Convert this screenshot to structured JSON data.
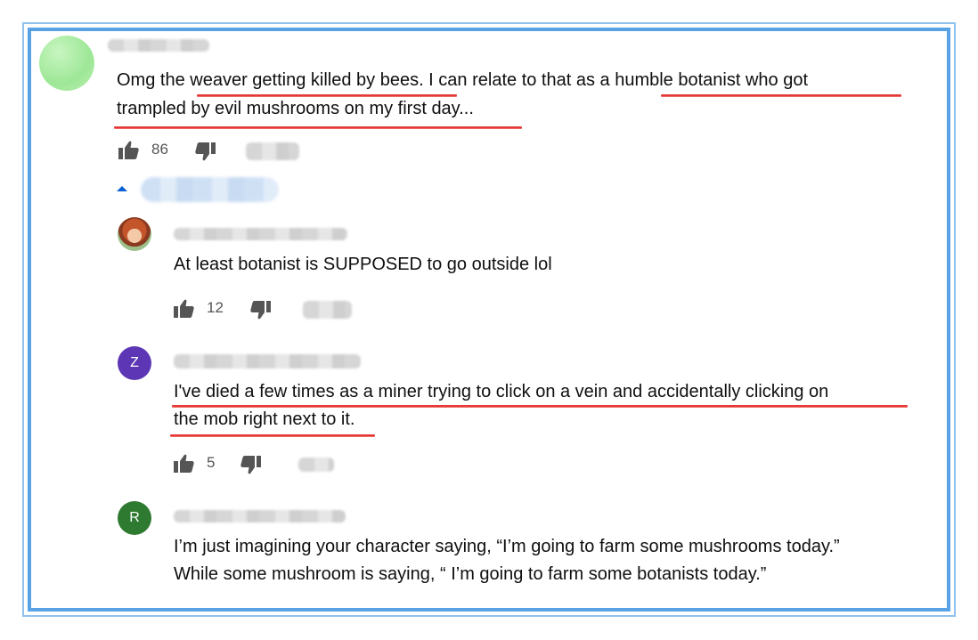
{
  "comments": [
    {
      "text": "Omg the weaver getting killed by bees. I can relate to that as a humble botanist who got trampled by evil mushrooms on my first day...",
      "line1": "Omg the weaver getting killed by bees. I can relate to that as a humble botanist who got",
      "line2": "trampled by evil mushrooms on my first day...",
      "likes": "86"
    }
  ],
  "replies": [
    {
      "avatar_initial": "",
      "text": "At least botanist is SUPPOSED to go outside lol",
      "likes": "12"
    },
    {
      "avatar_initial": "Z",
      "line1": "I've died a few times as a miner trying to click on a vein and accidentally clicking on",
      "line2": "the mob right next to it.",
      "likes": "5"
    },
    {
      "avatar_initial": "R",
      "line1": "I’m just imagining your character saying, “I’m going to farm some mushrooms today.”",
      "line2": "While some mushroom is saying, “ I’m going to farm some botanists today.”"
    }
  ],
  "colors": {
    "frame_outer": "#8fc2ef",
    "frame_inner": "#5aa2e6",
    "underline": "#e53935",
    "link_blue": "#065fd4",
    "avatar_z": "#5c36b4",
    "avatar_r": "#2f7a31"
  },
  "icons": [
    "thumb-up-icon",
    "thumb-down-icon",
    "caret-up-icon"
  ]
}
